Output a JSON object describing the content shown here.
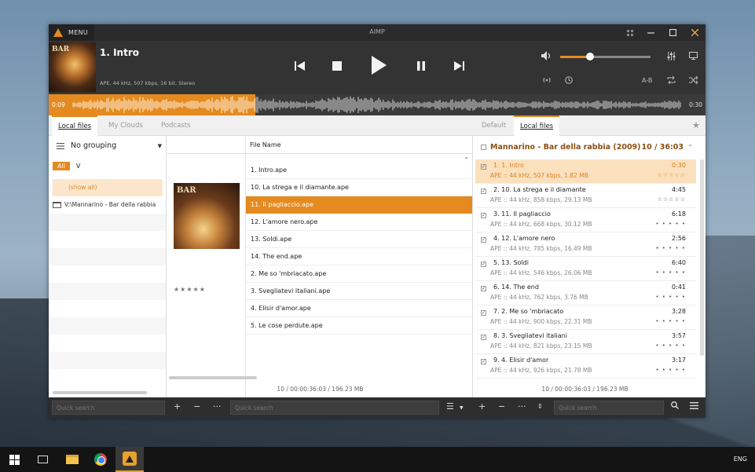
{
  "window": {
    "app_title": "AIMP",
    "menu_label": "MENU"
  },
  "player": {
    "track_title": "1. Intro",
    "track_info": "APE, 44 kHz, 507 kbps, 16 bit, Stereo",
    "volume_fraction": 0.33,
    "ab_label": "A-B",
    "time_current": "0:09",
    "time_total": "0:30",
    "progress_fraction": 0.3
  },
  "tabs": {
    "left": [
      "Local files",
      "My Clouds",
      "Podcasts"
    ],
    "left_active": 0,
    "right": [
      "Default",
      "Local files"
    ],
    "right_active": 1
  },
  "library": {
    "grouping_label": "No grouping",
    "filter_all": "All",
    "filter_value": "V",
    "show_all": "(show all)",
    "folder_path": "V:\\Mannarino - Bar della rabbia"
  },
  "files": {
    "column_header": "File Name",
    "cover_text": "BAR",
    "rating": "★★★★★",
    "rows": [
      "1. Intro.ape",
      "10. La strega e il diamante.ape",
      "11. Il pagliaccio.ape",
      "12. L'amore nero.ape",
      "13. Soldi.ape",
      "14. The end.ape",
      "2. Me so 'mbriacato.ape",
      "3. Svegliatevi italiani.ape",
      "4. Elisir d'amor.ape",
      "5. Le cose perdute.ape"
    ],
    "selected_index": 2,
    "footer": "10 / 00:00:36:03 / 196.23 MB"
  },
  "playlist": {
    "album_header": "Mannarino - Bar della rabbia (2009)",
    "count_header": "10 / 36:03",
    "items": [
      {
        "name": "1. 1. Intro",
        "info": "APE :: 44 kHz, 507 kbps, 1.82 MB",
        "duration": "0:30",
        "rating": "☆☆☆☆☆"
      },
      {
        "name": "2. 10. La strega e il diamante",
        "info": "APE :: 44 kHz, 858 kbps, 29.13 MB",
        "duration": "4:45",
        "rating": "☆☆☆☆☆"
      },
      {
        "name": "3. 11. Il pagliaccio",
        "info": "APE :: 44 kHz, 668 kbps, 30.12 MB",
        "duration": "6:18",
        "rating": "• • • • •"
      },
      {
        "name": "4. 12. L'amore nero",
        "info": "APE :: 44 kHz, 785 kbps, 16.49 MB",
        "duration": "2:56",
        "rating": "• • • • •"
      },
      {
        "name": "5. 13. Soldi",
        "info": "APE :: 44 kHz, 546 kbps, 26.06 MB",
        "duration": "6:40",
        "rating": "• • • • •"
      },
      {
        "name": "6. 14. The end",
        "info": "APE :: 44 kHz, 762 kbps, 3.76 MB",
        "duration": "0:41",
        "rating": "• • • • •"
      },
      {
        "name": "7. 2. Me so 'mbriacato",
        "info": "APE :: 44 kHz, 900 kbps, 22.31 MB",
        "duration": "3:28",
        "rating": "• • • • •"
      },
      {
        "name": "8. 3. Svegliatevi italiani",
        "info": "APE :: 44 kHz, 821 kbps, 23.15 MB",
        "duration": "3:57",
        "rating": "• • • • •"
      },
      {
        "name": "9. 4. Elisir d'amor",
        "info": "APE :: 44 kHz, 926 kbps, 21.78 MB",
        "duration": "3:17",
        "rating": "• • • • •"
      }
    ],
    "playing_index": 0,
    "footer": "10 / 00:00:36:03 / 196.23 MB"
  },
  "bottom": {
    "quick_search_1": "Quick search",
    "quick_search_2": "Quick search",
    "quick_search_3": "Quick search"
  },
  "taskbar": {
    "language": "ENG"
  },
  "colors": {
    "accent": "#e58a1f",
    "dark_bg": "#333333"
  }
}
